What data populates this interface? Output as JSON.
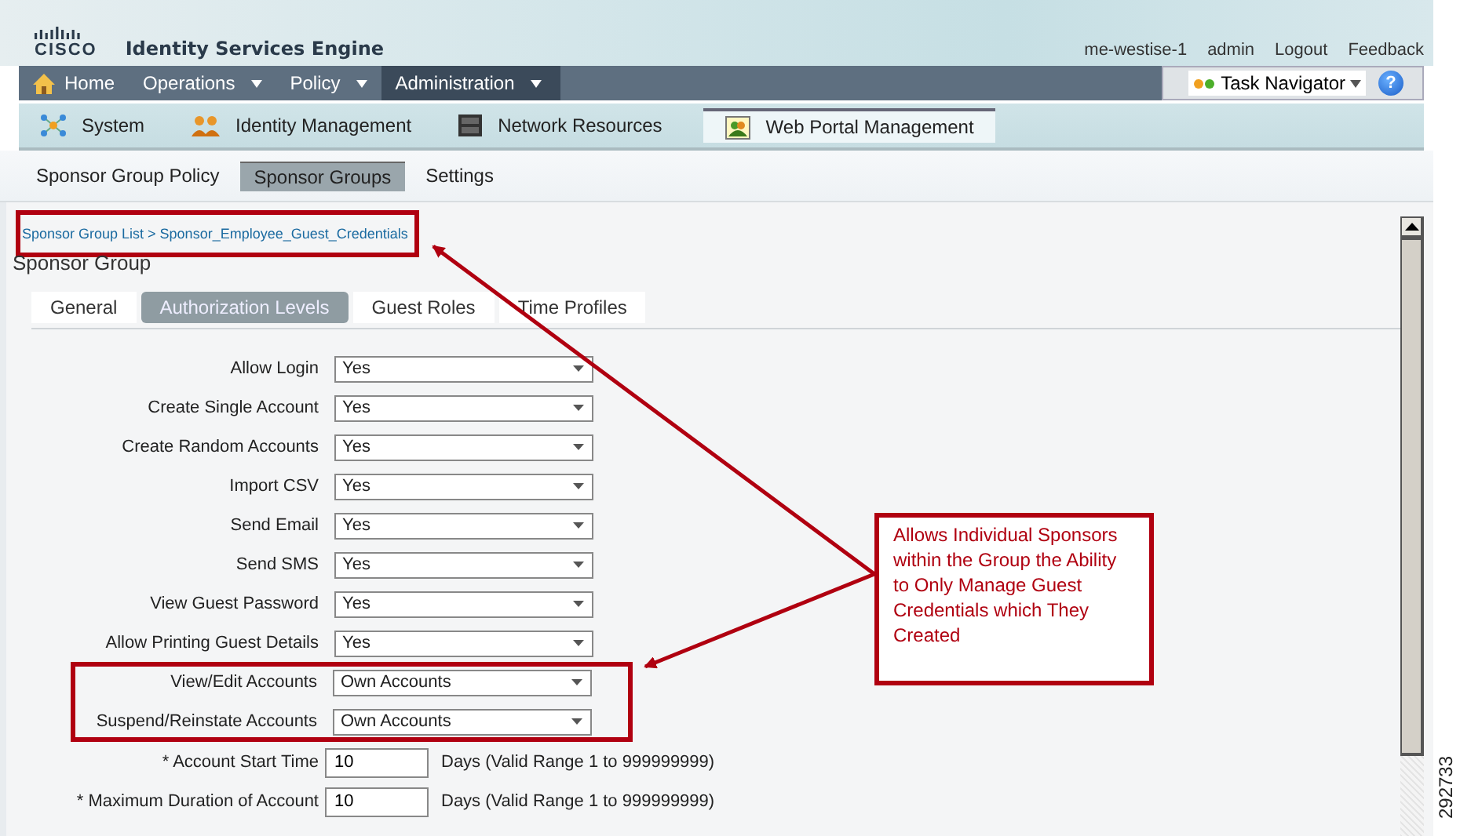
{
  "header": {
    "logo_text": "CISCO",
    "product": "Identity Services Engine",
    "user_links": [
      "me-westise-1",
      "admin",
      "Logout",
      "Feedback"
    ]
  },
  "main_nav": [
    {
      "label": "Home",
      "kind": "home",
      "selected": false
    },
    {
      "label": "Operations",
      "kind": "menu",
      "selected": false
    },
    {
      "label": "Policy",
      "kind": "menu",
      "selected": false
    },
    {
      "label": "Administration",
      "kind": "menu",
      "selected": true
    }
  ],
  "task_navigator": {
    "label": "Task Navigator",
    "help_glyph": "?"
  },
  "sub_nav": [
    {
      "label": "System",
      "kind": "system",
      "selected": false
    },
    {
      "label": "Identity Management",
      "kind": "identity",
      "selected": false
    },
    {
      "label": "Network Resources",
      "kind": "network",
      "selected": false
    },
    {
      "label": "Web Portal Management",
      "kind": "portal",
      "selected": true
    }
  ],
  "section_nav": [
    {
      "label": "Sponsor Group Policy",
      "selected": false
    },
    {
      "label": "Sponsor Groups",
      "selected": true
    },
    {
      "label": "Settings",
      "selected": false
    }
  ],
  "breadcrumb": {
    "text": "Sponsor Group List > Sponsor_Employee_Guest_Credentials",
    "highlighted": true
  },
  "page_title": "Sponsor Group",
  "tabs": [
    {
      "label": "General",
      "selected": false
    },
    {
      "label": "Authorization Levels",
      "selected": true
    },
    {
      "label": "Guest Roles",
      "selected": false
    },
    {
      "label": "Time Profiles",
      "selected": false
    }
  ],
  "fields": [
    {
      "label": "Allow Login",
      "kind": "select",
      "value": "Yes",
      "highlighted": false
    },
    {
      "label": "Create Single Account",
      "kind": "select",
      "value": "Yes",
      "highlighted": false
    },
    {
      "label": "Create Random Accounts",
      "kind": "select",
      "value": "Yes",
      "highlighted": false
    },
    {
      "label": "Import CSV",
      "kind": "select",
      "value": "Yes",
      "highlighted": false
    },
    {
      "label": "Send Email",
      "kind": "select",
      "value": "Yes",
      "highlighted": false
    },
    {
      "label": "Send SMS",
      "kind": "select",
      "value": "Yes",
      "highlighted": false
    },
    {
      "label": "View Guest Password",
      "kind": "select",
      "value": "Yes",
      "highlighted": false
    },
    {
      "label": "Allow Printing Guest Details",
      "kind": "select",
      "value": "Yes",
      "highlighted": false
    },
    {
      "label": "View/Edit Accounts",
      "kind": "select",
      "value": "Own Accounts",
      "highlighted": true
    },
    {
      "label": "Suspend/Reinstate Accounts",
      "kind": "select",
      "value": "Own Accounts",
      "highlighted": true
    },
    {
      "label": "* Account Start Time",
      "kind": "text",
      "value": "10",
      "hint": "Days (Valid Range 1 to 999999999)",
      "highlighted": false
    },
    {
      "label": "* Maximum Duration of Account",
      "kind": "text",
      "value": "10",
      "hint": "Days (Valid Range 1 to 999999999)",
      "highlighted": false
    }
  ],
  "callout": {
    "text": "Allows Individual Sponsors within the Group the Ability to Only Manage Guest Credentials which They Created"
  },
  "figure_number": "292733"
}
